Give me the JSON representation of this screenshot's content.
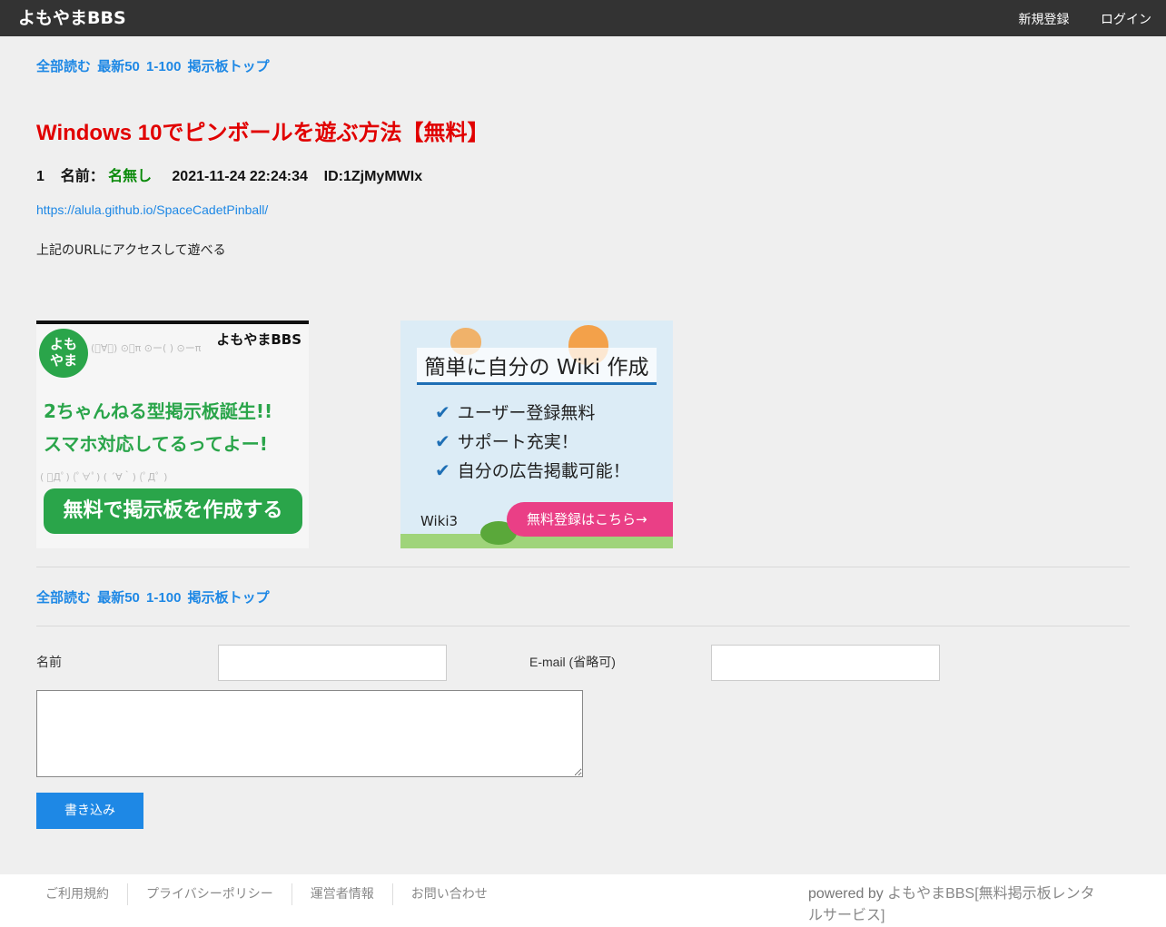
{
  "header": {
    "logo": "よもやまBBS",
    "register": "新規登録",
    "login": "ログイン"
  },
  "nav": {
    "read_all": "全部読む",
    "latest50": "最新50",
    "range": "1-100",
    "board_top": "掲示板トップ"
  },
  "thread": {
    "title": "Windows 10でピンボールを遊ぶ方法【無料】"
  },
  "post": {
    "number": "1",
    "name_label": "名前：",
    "name": "名無し",
    "date": "2021-11-24 22:24:34",
    "id": "ID:1ZjMyMWIx",
    "link": "https://alula.github.io/SpaceCadetPinball/",
    "body": "上記のURLにアクセスして遊べる"
  },
  "ads": {
    "yomoyama": {
      "circle": "よも\nやま",
      "brand": "よもやまBBS",
      "line1": "2ちゃんねる型掲示板誕生!!",
      "line2": "スマホ対応してるってよー!",
      "button": "無料で掲示板を作成する"
    },
    "wiki": {
      "title": "簡単に自分の Wiki 作成",
      "items": [
        "ユーザー登録無料",
        "サポート充実！",
        "自分の広告掲載可能！"
      ],
      "button": "無料登録はこちら→",
      "brand": "Wiki3"
    }
  },
  "form": {
    "name_label": "名前",
    "email_label": "E-mail (省略可)",
    "name_value": "",
    "email_value": "",
    "message_value": "",
    "submit": "書き込み"
  },
  "footer": {
    "links": [
      "ご利用規約",
      "プライバシーポリシー",
      "運営者情報",
      "お問い合わせ"
    ],
    "powered_prefix": "powered by ",
    "powered_link": "よもやまBBS[無料掲示板レンタルサービス]"
  }
}
